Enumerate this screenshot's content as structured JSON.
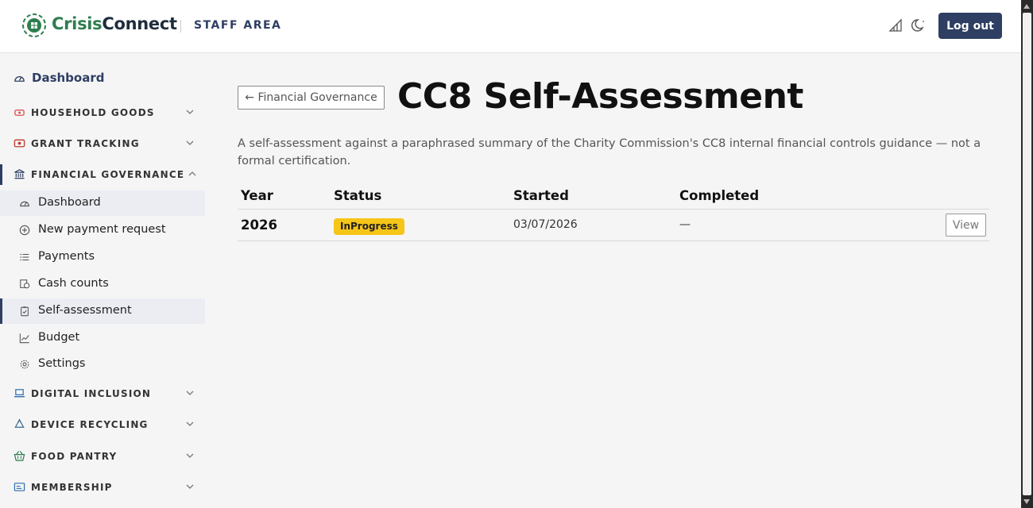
{
  "header": {
    "brand_part1": "Crisis",
    "brand_part2": "Connect",
    "area_label": "STAFF AREA",
    "logout_label": "Log out"
  },
  "sidebar": {
    "top_item": "Dashboard",
    "sections": [
      {
        "label": "HOUSEHOLD GOODS",
        "icon": "sofa-icon"
      },
      {
        "label": "GRANT TRACKING",
        "icon": "wallet-icon"
      },
      {
        "label": "FINANCIAL GOVERNANCE",
        "icon": "bank-icon"
      },
      {
        "label": "DIGITAL INCLUSION",
        "icon": "laptop-icon"
      },
      {
        "label": "DEVICE RECYCLING",
        "icon": "recycle-icon"
      },
      {
        "label": "FOOD PANTRY",
        "icon": "basket-icon"
      },
      {
        "label": "MEMBERSHIP",
        "icon": "id-card-icon"
      }
    ],
    "financial_items": [
      {
        "label": "Dashboard",
        "icon": "gauge-icon"
      },
      {
        "label": "New payment request",
        "icon": "plus-circle-icon"
      },
      {
        "label": "Payments",
        "icon": "list-icon"
      },
      {
        "label": "Cash counts",
        "icon": "cash-icon"
      },
      {
        "label": "Self-assessment",
        "icon": "clipboard-check-icon"
      },
      {
        "label": "Budget",
        "icon": "chart-line-icon"
      },
      {
        "label": "Settings",
        "icon": "gear-icon"
      }
    ]
  },
  "main": {
    "back_label": "← Financial Governance",
    "title": "CC8 Self-Assessment",
    "description": "A self-assessment against a paraphrased summary of the Charity Commission's CC8 internal financial controls guidance — not a formal certification.",
    "table": {
      "headers": [
        "Year",
        "Status",
        "Started",
        "Completed"
      ],
      "rows": [
        {
          "year": "2026",
          "status": "InProgress",
          "started": "03/07/2026",
          "completed": "—",
          "action": "View"
        }
      ]
    }
  },
  "colors": {
    "primary": "#2f3e63",
    "brand_green": "#2e7d4f",
    "badge_yellow": "#f5c518"
  }
}
